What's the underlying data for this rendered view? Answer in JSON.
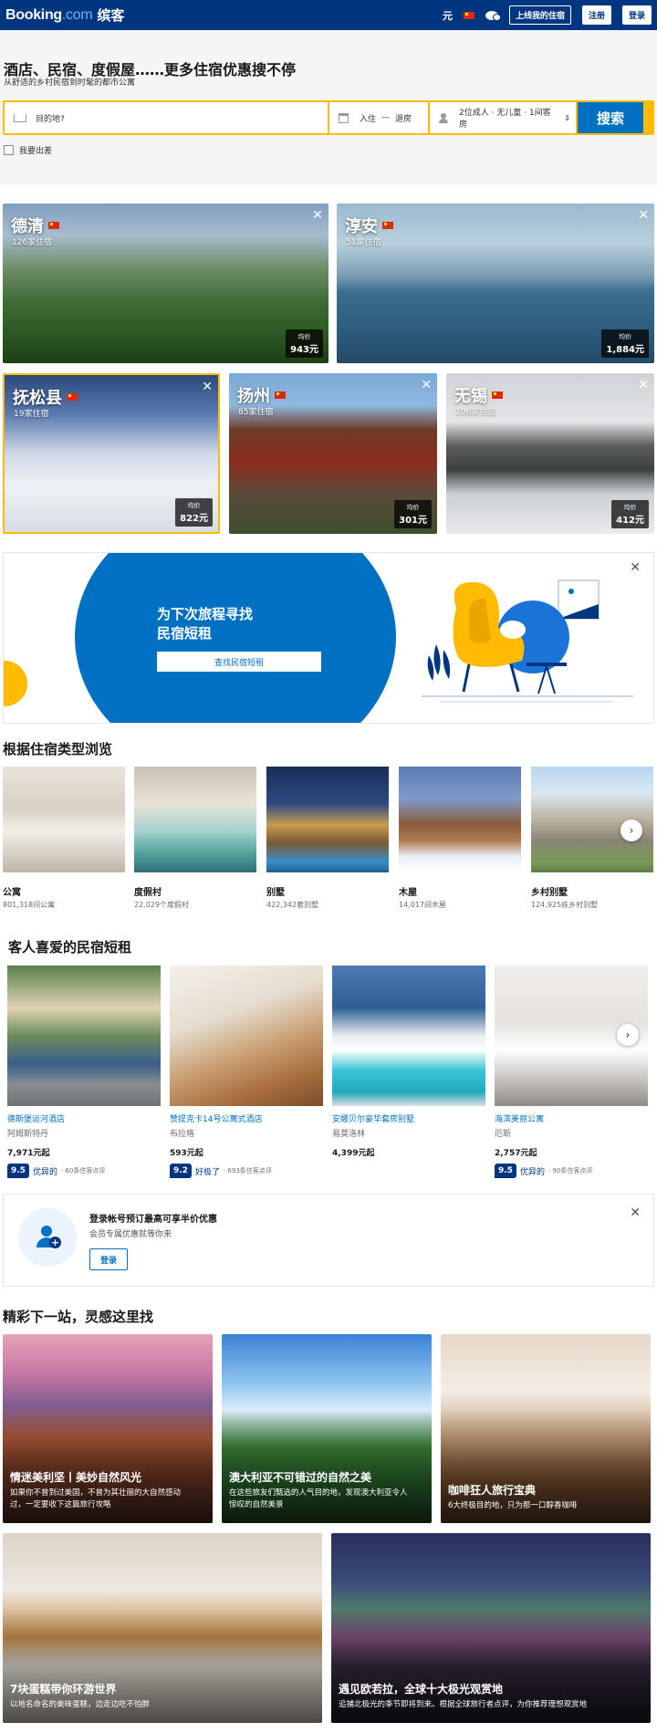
{
  "header": {
    "brand": "Booking",
    "brand_suffix": ".com",
    "brand_cn": "缤客",
    "currency": "元",
    "list_property": "上线我的住宿",
    "register": "注册",
    "login": "登录"
  },
  "search": {
    "title": "酒店、民宿、度假屋……更多住宿优惠搜不停",
    "subtitle": "从舒适的乡村民宿到时髦的都市公寓",
    "destination_placeholder": "目的地?",
    "checkin": "入住",
    "date_sep": "—",
    "checkout": "退房",
    "guests": "2位成人 · 无儿童 · 1间客房",
    "submit": "搜索",
    "business_trip": "我要出差"
  },
  "destinations": [
    {
      "name": "德清",
      "count": "126家住宿",
      "price_label": "均价",
      "price": "943元"
    },
    {
      "name": "淳安",
      "count": "51家住宿",
      "price_label": "均价",
      "price": "1,884元"
    },
    {
      "name": "抚松县",
      "count": "19家住宿",
      "price_label": "均价",
      "price": "822元"
    },
    {
      "name": "扬州",
      "count": "85家住宿",
      "price_label": "均价",
      "price": "301元"
    },
    {
      "name": "无锡",
      "count": "196家住宿",
      "price_label": "均价",
      "price": "412元"
    }
  ],
  "banner": {
    "title_line1": "为下次旅程寻找",
    "title_line2": "民宿短租",
    "button": "查找民宿短租"
  },
  "property_types": {
    "title": "根据住宿类型浏览",
    "items": [
      {
        "name": "公寓",
        "count": "801,318间公寓"
      },
      {
        "name": "度假村",
        "count": "22,029个度假村"
      },
      {
        "name": "别墅",
        "count": "422,342套别墅"
      },
      {
        "name": "木屋",
        "count": "14,017间木屋"
      },
      {
        "name": "乡村别墅",
        "count": "124,925栋乡村别墅"
      }
    ]
  },
  "homes": {
    "title": "客人喜爱的民宿短租",
    "items": [
      {
        "name": "德斯堡运河酒店",
        "city": "阿姆斯特丹",
        "price": "7,971元起",
        "score": "9.5",
        "word": "优异的",
        "reviews": "· 60条住客点评"
      },
      {
        "name": "赞提克卡14号公寓式酒店",
        "city": "布拉格",
        "price": "593元起",
        "score": "9.2",
        "word": "好极了",
        "reviews": "· 693条住客点评"
      },
      {
        "name": "安娜贝尔豪华套房别墅",
        "city": "易莫洛林",
        "price": "4,399元起",
        "score": "",
        "word": "",
        "reviews": ""
      },
      {
        "name": "海滨美丽公寓",
        "city": "厄斯",
        "price": "2,757元起",
        "score": "9.5",
        "word": "优异的",
        "reviews": "· 90条住客点评"
      }
    ]
  },
  "login_box": {
    "title": "登录帐号预订最高可享半价优惠",
    "subtitle": "会员专属优惠就等你来",
    "button": "登录"
  },
  "inspiration": {
    "title": "精彩下一站，灵感这里找",
    "items": [
      {
        "title": "情迷美利坚丨美妙自然风光",
        "desc1": "如果你不曾到过美国，不曾为其壮丽的大自然感动",
        "desc2": "过，一定要收下这篇旅行攻略"
      },
      {
        "title": "澳大利亚不可错过的自然之美",
        "desc1": "在这些旅友们甄选的人气目的地，发现澳大利亚令人",
        "desc2": "惊叹的自然美景"
      },
      {
        "title": "咖啡狂人旅行宝典",
        "desc1": "6大终极目的地，只为那一口醇香咖啡",
        "desc2": ""
      },
      {
        "title": "7块蛋糕带你环游世界",
        "desc1": "以地名命名的美味蛋糕，边走边吃不怕胖",
        "desc2": ""
      },
      {
        "title": "遇见欧若拉，全球十大极光观赏地",
        "desc1": "追捕北极光的季节即将到来。根据全球旅行者点评，为你推荐理想观赏地",
        "desc2": ""
      }
    ]
  },
  "colors": {
    "brand_dark": "#003580",
    "brand_blue": "#0071c2",
    "search_yellow": "#febb02"
  }
}
